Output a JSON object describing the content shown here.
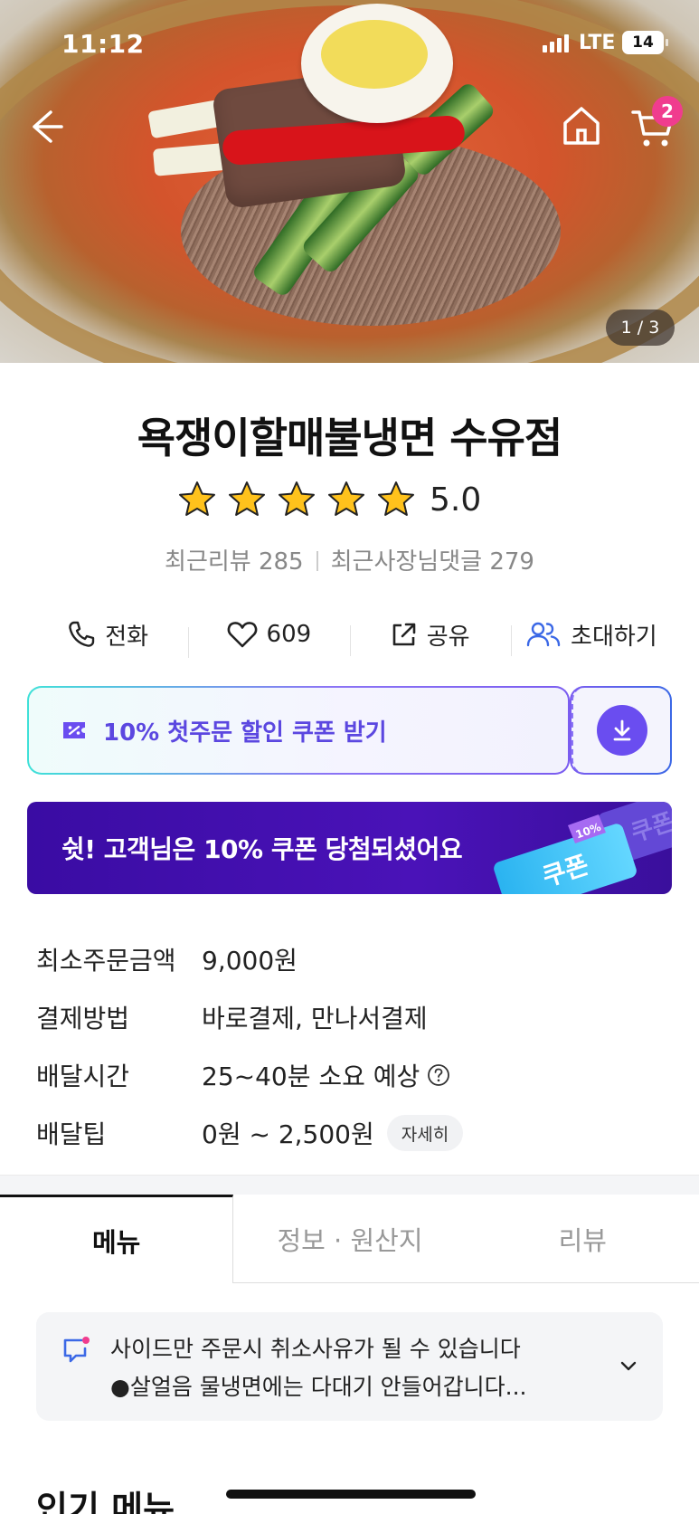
{
  "status_bar": {
    "time": "11:12",
    "network": "LTE",
    "battery": "14"
  },
  "hero": {
    "page_indicator": "1 / 3"
  },
  "header": {
    "cart_count": "2"
  },
  "store": {
    "name": "욕쟁이할매불냉면 수유점",
    "rating": "5.0",
    "rating_stars": 5,
    "recent_reviews": "최근리뷰 285",
    "owner_comments": "최근사장님댓글 279"
  },
  "actions": {
    "call": "전화",
    "likes": "609",
    "share": "공유",
    "invite": "초대하기"
  },
  "coupon": {
    "label": "10% 첫주문 할인 쿠폰 받기"
  },
  "banner": {
    "text": "쉿! 고객님은 10% 쿠폰 당첨되셨어요",
    "ticket_label": "쿠폰",
    "ticket_tag": "10%"
  },
  "info": {
    "rows": [
      {
        "label": "최소주문금액",
        "value": "9,000원"
      },
      {
        "label": "결제방법",
        "value": "바로결제, 만나서결제"
      },
      {
        "label": "배달시간",
        "value": "25~40분 소요 예상"
      },
      {
        "label": "배달팁",
        "value": "0원 ~ 2,500원"
      }
    ],
    "detail_button": "자세히"
  },
  "tabs": [
    {
      "label": "메뉴",
      "active": true
    },
    {
      "label": "정보 · 원산지",
      "active": false
    },
    {
      "label": "리뷰",
      "active": false
    }
  ],
  "notice": {
    "line1": "사이드만 주문시 취소사유가 될 수 있습니다",
    "line2": "●살얼음 물냉면에는 다대기 안들어갑니다..."
  },
  "section": {
    "popular_title": "인기 메뉴"
  },
  "colors": {
    "accent_purple": "#5b47e0",
    "banner_purple": "#3a0ca3",
    "badge_pink": "#f03c8e",
    "invite_blue": "#3b68e6"
  }
}
